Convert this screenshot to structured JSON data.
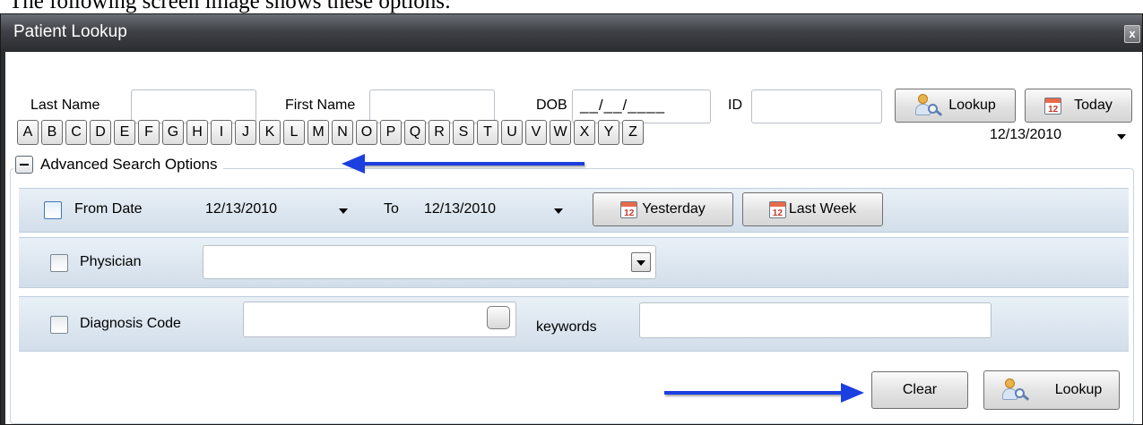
{
  "caption": "The following screen image shows these options:",
  "window": {
    "title": "Patient Lookup",
    "close_label": "x"
  },
  "search": {
    "last_name_label": "Last Name",
    "last_name_value": "",
    "first_name_label": "First Name",
    "first_name_value": "",
    "dob_label": "DOB",
    "dob_value": "__/__/____",
    "id_label": "ID",
    "id_value": "",
    "lookup_button": "Lookup",
    "today_button": "Today",
    "date_value": "12/13/2010",
    "calendar_icon_text": "12"
  },
  "letters": [
    "A",
    "B",
    "C",
    "D",
    "E",
    "F",
    "G",
    "H",
    "I",
    "J",
    "K",
    "L",
    "M",
    "N",
    "O",
    "P",
    "Q",
    "R",
    "S",
    "T",
    "U",
    "V",
    "W",
    "X",
    "Y",
    "Z"
  ],
  "advanced": {
    "title": "Advanced Search Options",
    "from_date_label": "From Date",
    "from_date_value": "12/13/2010",
    "to_label": "To",
    "to_date_value": "12/13/2010",
    "yesterday_button": "Yesterday",
    "last_week_button": "Last Week",
    "physician_label": "Physician",
    "physician_value": "",
    "diagnosis_label": "Diagnosis Code",
    "diagnosis_value": "",
    "keywords_label": "keywords",
    "keywords_value": "",
    "from_date_checked": false,
    "physician_checked": false,
    "diagnosis_checked": false
  },
  "footer": {
    "clear_button": "Clear",
    "lookup_button": "Lookup"
  },
  "colors": {
    "annotation_arrow": "#1c3fe0",
    "titlebar": "#3e4146",
    "band": "#d2deea"
  },
  "icons": {
    "calendar": "calendar-icon",
    "lookup": "person-search-icon",
    "collapse": "minus-toggle-icon",
    "dropdown": "chevron-down-icon",
    "close": "close-icon"
  }
}
